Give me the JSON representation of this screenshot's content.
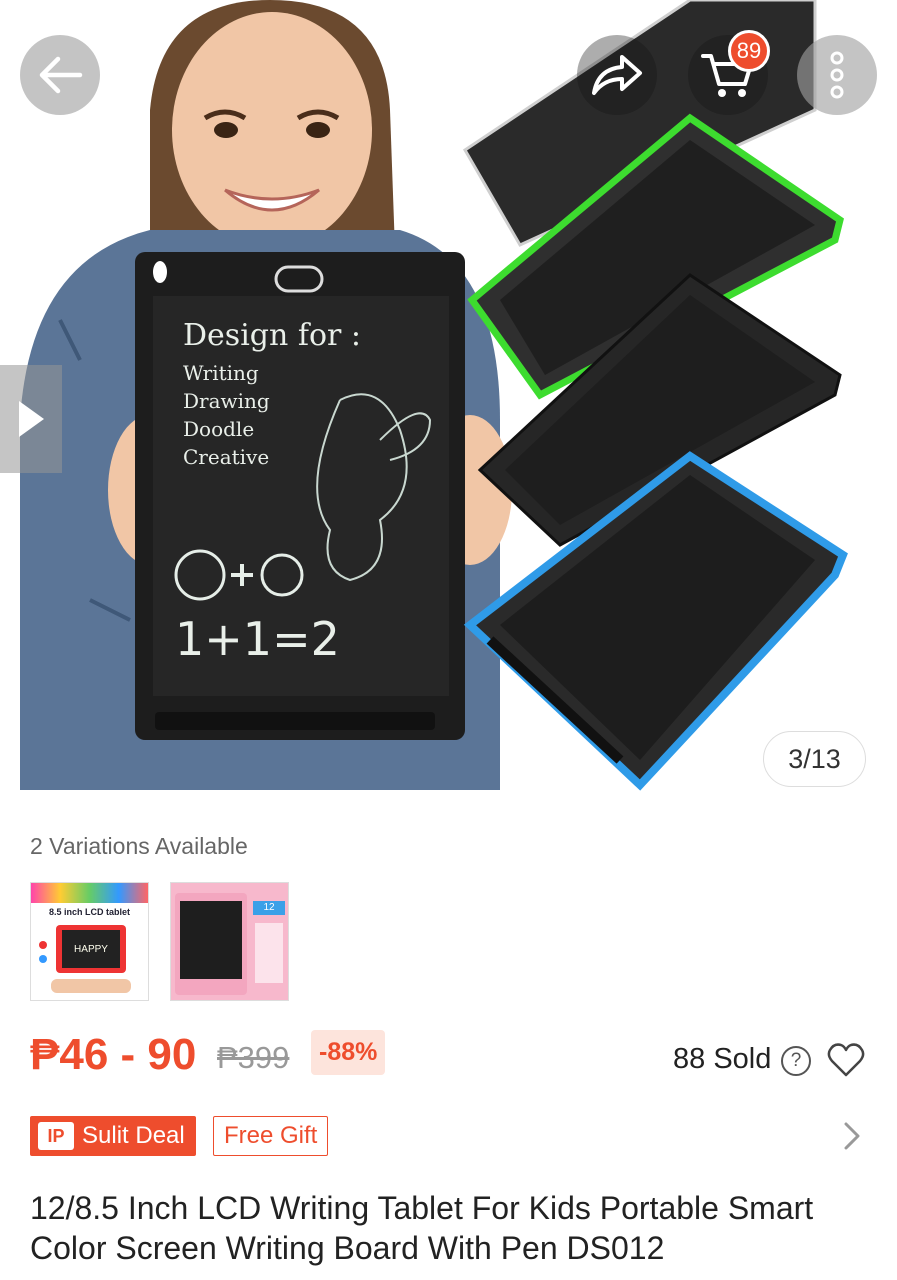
{
  "header": {
    "back_icon": "arrow-left-icon",
    "share_icon": "share-arrow-icon",
    "cart_icon": "shopping-cart-icon",
    "cart_count": "89",
    "more_icon": "more-vertical-icon"
  },
  "gallery": {
    "counter": "3/13",
    "play_icon": "play-icon",
    "screen_text": {
      "heading": "Design for :",
      "items": [
        "Writing",
        "Drawing",
        "Doodle",
        "Creative"
      ],
      "equation": "1+1=2"
    }
  },
  "variations": {
    "label": "2 Variations Available",
    "thumb1_caption": "8.5 inch LCD tablet",
    "thumb1_screen": "HAPPY",
    "thumb2_caption": "12"
  },
  "pricing": {
    "price_range": "₱46 - 90",
    "original_price": "₱399",
    "discount": "-88%",
    "sold": "88 Sold",
    "help_icon": "?"
  },
  "badges": {
    "sulit_logo": "IP",
    "sulit_deal": "Sulit Deal",
    "free_gift": "Free Gift"
  },
  "product": {
    "title": "12/8.5 Inch LCD Writing Tablet For Kids Portable Smart Color Screen Writing Board With Pen DS012"
  },
  "colors": {
    "accent": "#ee4d2d",
    "green_tablet": "#3ddc2f",
    "blue_tablet": "#2f9be8"
  }
}
